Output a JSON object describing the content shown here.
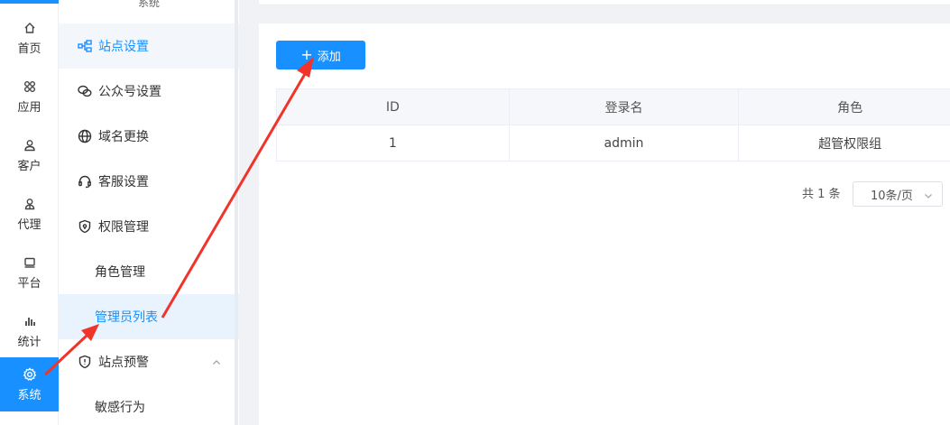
{
  "rail": {
    "items": [
      {
        "label": "首页",
        "icon": "home-icon"
      },
      {
        "label": "应用",
        "icon": "apps-icon"
      },
      {
        "label": "客户",
        "icon": "user-icon"
      },
      {
        "label": "代理",
        "icon": "agent-icon"
      },
      {
        "label": "平台",
        "icon": "platform-icon"
      },
      {
        "label": "统计",
        "icon": "chart-icon"
      },
      {
        "label": "系统",
        "icon": "gear-icon"
      }
    ],
    "active": "系统",
    "accent": "#1890ff"
  },
  "sidebar": {
    "title": "系统",
    "items": [
      {
        "label": "站点设置",
        "icon": "sitemap-icon"
      },
      {
        "label": "公众号设置",
        "icon": "wechat-icon"
      },
      {
        "label": "域名更换",
        "icon": "globe-icon"
      },
      {
        "label": "客服设置",
        "icon": "headset-icon"
      },
      {
        "label": "权限管理",
        "icon": "shield-icon"
      },
      {
        "label": "角色管理"
      },
      {
        "label": "管理员列表"
      },
      {
        "label": "站点预警",
        "icon": "shield-alert-icon"
      },
      {
        "label": "敏感行为"
      }
    ],
    "selected": "管理员列表"
  },
  "main": {
    "add_button": "添加",
    "table": {
      "headers": [
        "ID",
        "登录名",
        "角色"
      ],
      "rows": [
        [
          "1",
          "admin",
          "超管权限组"
        ]
      ]
    },
    "pager": {
      "total": "共 1 条",
      "page_size": "10条/页"
    }
  },
  "annotation_color": "#f0342a"
}
